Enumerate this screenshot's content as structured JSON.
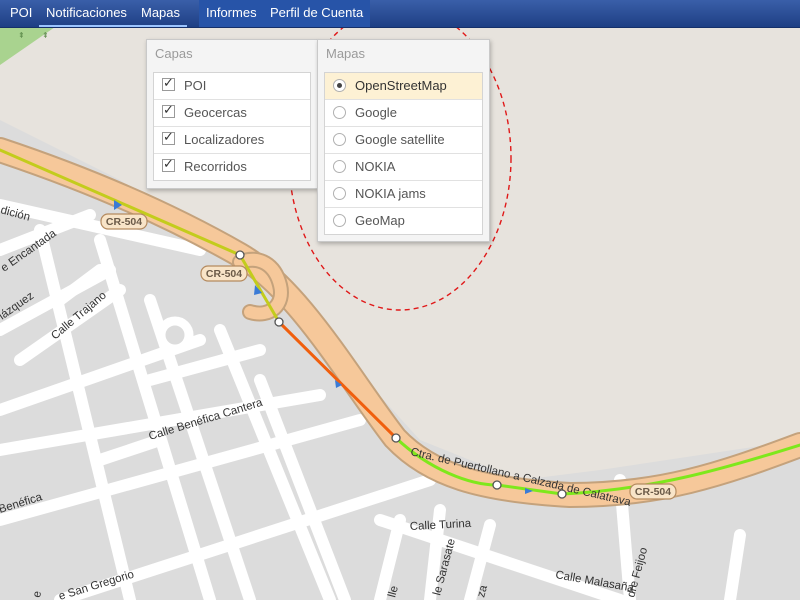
{
  "topbar": {
    "tabs": [
      {
        "label": "POI"
      },
      {
        "label": "Notificaciones"
      },
      {
        "label": "Mapas"
      },
      {
        "label": "Informes"
      },
      {
        "label": "Perfil de Cuenta"
      }
    ]
  },
  "layers_menu": {
    "title": "Capas",
    "items": [
      {
        "label": "POI",
        "checked": true
      },
      {
        "label": "Geocercas",
        "checked": true
      },
      {
        "label": "Localizadores",
        "checked": true
      },
      {
        "label": "Recorridos",
        "checked": true
      }
    ]
  },
  "maps_menu": {
    "title": "Mapas",
    "selected": "OpenStreetMap",
    "items": [
      {
        "label": "OpenStreetMap"
      },
      {
        "label": "Google"
      },
      {
        "label": "Google satellite"
      },
      {
        "label": "NOKIA"
      },
      {
        "label": "NOKIA jams"
      },
      {
        "label": "GeoMap"
      }
    ]
  },
  "map": {
    "road_shields": [
      "CR-504",
      "CR-504",
      "CR-504"
    ],
    "streets": [
      "dición",
      "e Encantada",
      "lázquez",
      "Calle Trajano",
      "Calle Benéfica Cantera",
      "Benéfica",
      "e San Gregorio",
      "Ctra. de Puertollano a Calzada de Calatrava",
      "Calle Turina",
      "le Sarasate",
      "Calle Malasaña",
      "dre Feijoo",
      "lle",
      "za",
      "e"
    ],
    "colors": {
      "route_yellow": "#c3cc1c",
      "route_green": "#7ee81c",
      "route_orange": "#f05f0e",
      "highway_fill": "#f6c89a",
      "selection_ellipse": "#e01818"
    }
  }
}
